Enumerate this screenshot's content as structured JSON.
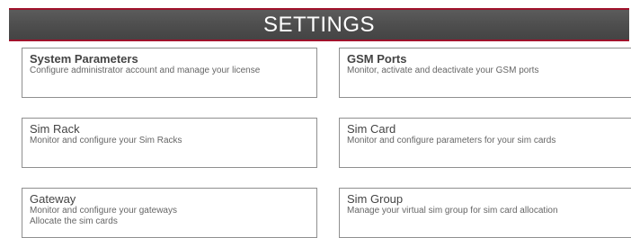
{
  "header": {
    "title": "SETTINGS"
  },
  "cards": [
    {
      "title": "System Parameters",
      "lines": [
        "Configure administrator account and manage your license"
      ]
    },
    {
      "title": "GSM Ports",
      "lines": [
        "Monitor, activate and deactivate your GSM ports"
      ]
    },
    {
      "title": "Sim Rack",
      "lines": [
        "Monitor and configure your Sim Racks"
      ]
    },
    {
      "title": "Sim Card",
      "lines": [
        "Monitor and configure parameters for your sim cards"
      ]
    },
    {
      "title": "Gateway",
      "lines": [
        "Monitor and configure your gateways",
        "Allocate the sim cards"
      ]
    },
    {
      "title": "Sim Group",
      "lines": [
        "Manage your virtual sim group for sim card allocation"
      ]
    }
  ]
}
